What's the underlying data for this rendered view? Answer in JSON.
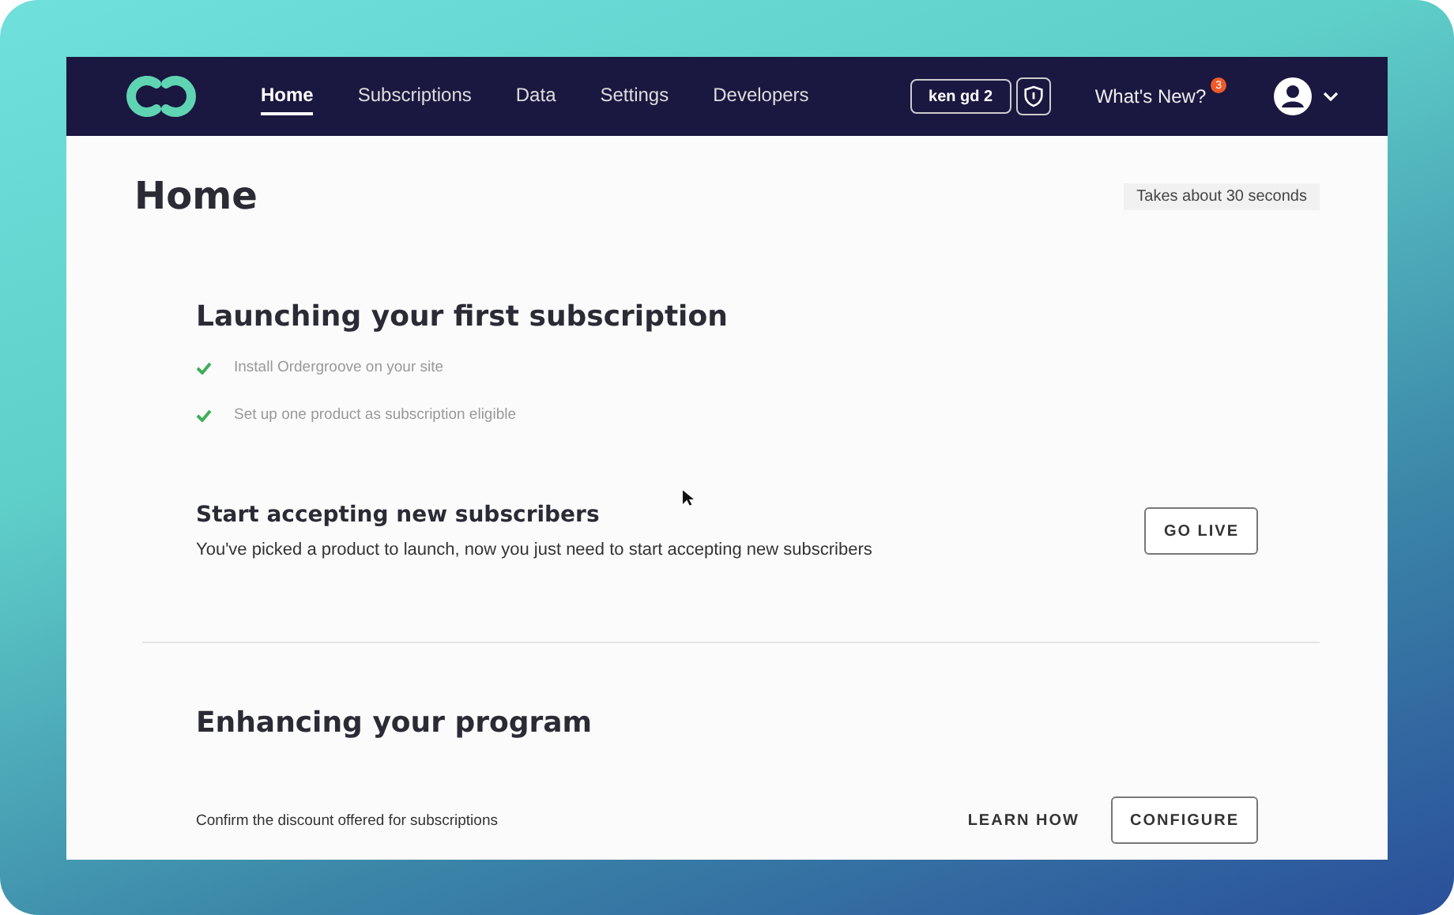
{
  "nav": {
    "items": [
      {
        "label": "Home",
        "selected": true
      },
      {
        "label": "Subscriptions",
        "selected": false
      },
      {
        "label": "Data",
        "selected": false
      },
      {
        "label": "Settings",
        "selected": false
      },
      {
        "label": "Developers",
        "selected": false
      }
    ],
    "account": "ken gd 2",
    "whats_new": "What's New?",
    "badge": "3"
  },
  "page": {
    "title": "Home",
    "time_note": "Takes about 30 seconds"
  },
  "launch": {
    "title": "Launching your first subscription",
    "steps": [
      {
        "label": "Install Ordergroove on your site",
        "checked": true
      },
      {
        "label": "Set up one product as subscription eligible",
        "checked": true
      }
    ],
    "task": {
      "title": "Start accepting new subscribers",
      "text": "You've picked a product to launch, now you just need to start accepting new subscribers",
      "button": "GO LIVE"
    }
  },
  "enhance": {
    "title": "Enhancing your program",
    "rows": [
      {
        "text": "Confirm the discount offered for subscriptions",
        "link": "LEARN HOW",
        "button": "CONFIGURE"
      }
    ]
  }
}
